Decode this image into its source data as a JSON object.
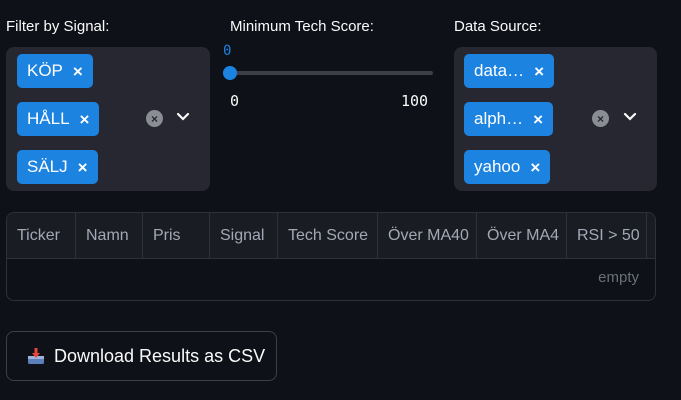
{
  "signal_filter": {
    "label": "Filter by Signal:",
    "chips": [
      "KÖP",
      "HÅLL",
      "SÄLJ"
    ]
  },
  "tech_score": {
    "label": "Minimum Tech Score:",
    "current": "0",
    "min": "0",
    "max": "100",
    "value": 0
  },
  "data_source": {
    "label": "Data Source:",
    "chips": [
      "data…",
      "alph…",
      "yahoo"
    ]
  },
  "table": {
    "columns": [
      "Ticker",
      "Namn",
      "Pris",
      "Signal",
      "Tech Score",
      "Över MA40",
      "Över MA4",
      "RSI > 50"
    ],
    "empty_text": "empty"
  },
  "download": {
    "label": "Download Results as CSV",
    "icon": "inbox-tray-icon"
  },
  "colors": {
    "background": "#0e1117",
    "accent": "#1c83e1",
    "widget_bg": "#262730"
  }
}
